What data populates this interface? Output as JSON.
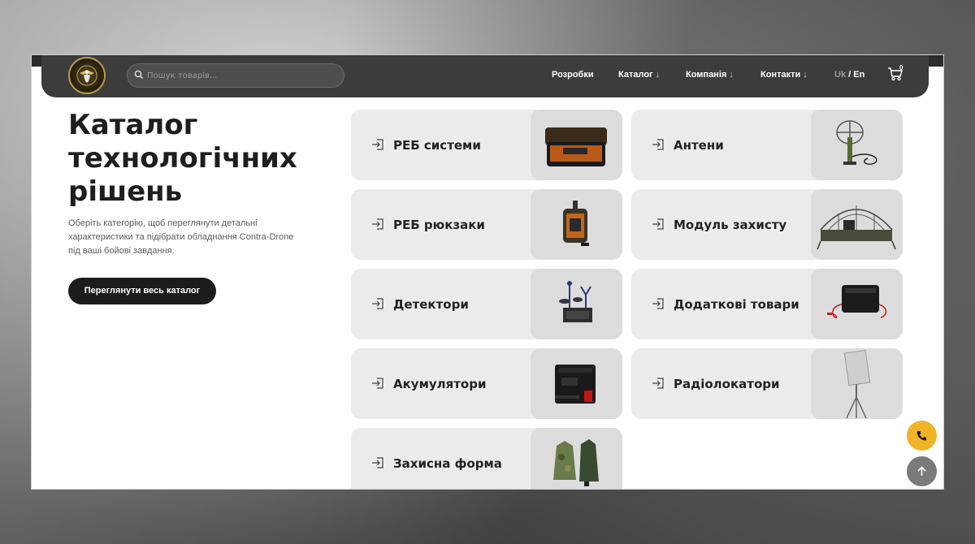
{
  "header": {
    "search_placeholder": "Пошук товарів...",
    "nav": [
      {
        "label": "Розробки",
        "arrow": ""
      },
      {
        "label": "Каталог",
        "arrow": "↓"
      },
      {
        "label": "Компанія",
        "arrow": "↓"
      },
      {
        "label": "Контакти",
        "arrow": "↓"
      }
    ],
    "lang_uk": "Uk",
    "lang_sep": "/",
    "lang_en": "En",
    "cart_count": "0"
  },
  "hero": {
    "title_line1": "Каталог",
    "title_line2": "технологічних",
    "title_line3": "рішень",
    "description": "Оберіть категорію, щоб переглянути детальні характеристики та підібрати обладнання Contra-Drone під ваші бойові завдання.",
    "cta_label": "Переглянути весь каталог"
  },
  "categories": [
    {
      "label": "РЕБ системи",
      "icon": "reb-system-case-image"
    },
    {
      "label": "Антени",
      "icon": "antenna-image"
    },
    {
      "label": "РЕБ рюкзаки",
      "icon": "reb-backpack-image"
    },
    {
      "label": "Модуль захисту",
      "icon": "protection-module-image"
    },
    {
      "label": "Детектори",
      "icon": "detector-image"
    },
    {
      "label": "Додаткові товари",
      "icon": "additional-goods-image"
    },
    {
      "label": "Акумулятори",
      "icon": "battery-image"
    },
    {
      "label": "Радіолокатори",
      "icon": "radar-image"
    },
    {
      "label": "Захисна форма",
      "icon": "protective-uniform-image"
    }
  ],
  "colors": {
    "header_bg": "#3c3c3c",
    "card_bg": "#ebebeb",
    "phone_button": "#f0b429",
    "scroll_top_button": "#7a7a7a"
  }
}
